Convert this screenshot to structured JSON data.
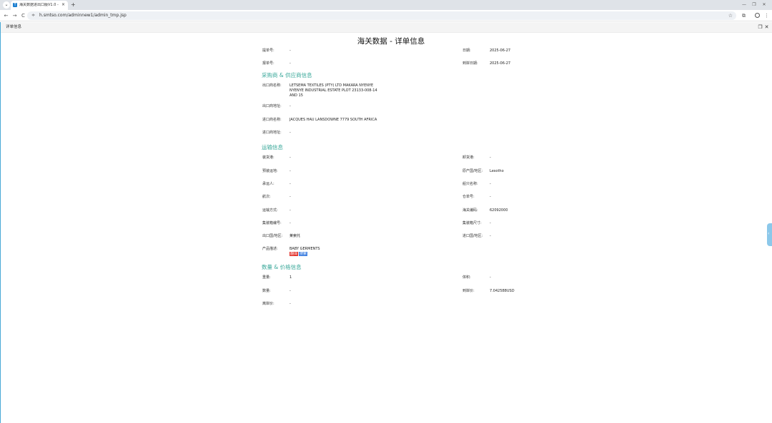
{
  "browser": {
    "tab_menu_icon": "chevron-down-icon",
    "tab_title": "海关数据进出口版V1.0 - 江苏",
    "tab_favicon_letter": "T",
    "tab_close": "×",
    "new_tab": "+",
    "window_min": "—",
    "window_max": "❐",
    "window_close": "✕",
    "back": "←",
    "forward": "→",
    "reload": "C",
    "site_icon": "≑",
    "url": "h.smtso.com/adminnew1/admin_tmp.jsp",
    "star": "☆",
    "extension": "⧉",
    "menu": "⋮"
  },
  "panel": {
    "title": "详单信息",
    "restore": "❐",
    "close": "✕"
  },
  "page_title": "海关数据 - 详单信息",
  "top_fields": {
    "bill_no_label": "提单号:",
    "bill_no_value": "-",
    "date_label": "日期:",
    "date_value": "2025-06-27",
    "declaration_no_label": "报单号:",
    "declaration_no_value": "-",
    "arrival_date_label": "到岸日期:",
    "arrival_date_value": "2025-06-27"
  },
  "buyer_supplier": {
    "heading": "采购商 & 供应商信息",
    "exporter_name_label": "出口商名称:",
    "exporter_name_value": "LETSEMA TEXTILES (PTY) LTD MAKARA NYENYE NYENYE INDUSTRIAL ESTATE PLOT 23133-008-14 AND 15",
    "exporter_address_label": "出口商地址:",
    "exporter_address_value": "-",
    "importer_name_label": "进口商名称:",
    "importer_name_value": "JACQUES HAU LANSDOWNE 7779 SOUTH AFRICA",
    "importer_address_label": "进口商地址:",
    "importer_address_value": "-"
  },
  "shipping": {
    "heading": "运输信息",
    "loading_port_label": "装货港:",
    "loading_port_value": "-",
    "unloading_port_label": "卸货港:",
    "unloading_port_value": "-",
    "destination_label": "预装运地:",
    "destination_value": "-",
    "origin_label": "原产国/地区:",
    "origin_value": "Lesotho",
    "carrier_label": "承运人:",
    "carrier_value": "-",
    "vessel_label": "船只名称:",
    "vessel_value": "-",
    "voyage_label": "航次:",
    "voyage_value": "-",
    "container_no_label": "仓单号:",
    "container_no_value": "-",
    "transport_mode_label": "运输方式:",
    "transport_mode_value": "-",
    "hs_code_label": "海关编码:",
    "hs_code_value": "62092000",
    "box_no_label": "集装箱编号:",
    "box_no_value": "-",
    "box_size_label": "集装箱尺寸:",
    "box_size_value": "-",
    "export_country_label": "出口国/地区:",
    "export_country_value": "莱索托",
    "import_country_label": "进口国/地区:",
    "import_country_value": "-",
    "product_desc_label": "产品描述:",
    "product_desc_value": "BABY GERMENTS",
    "tag_a": "翻译",
    "tag_b": "搜索"
  },
  "quantity_price": {
    "heading": "数量 & 价格信息",
    "weight_label": "重量:",
    "weight_value": "1",
    "volume_label": "体积:",
    "volume_value": "-",
    "quantity_label": "数量:",
    "quantity_value": "-",
    "unit_price_label": "到岸价:",
    "unit_price_value": "7.042588USD",
    "fob_label": "离岸价:",
    "fob_value": "-"
  },
  "side_handle": "‹"
}
